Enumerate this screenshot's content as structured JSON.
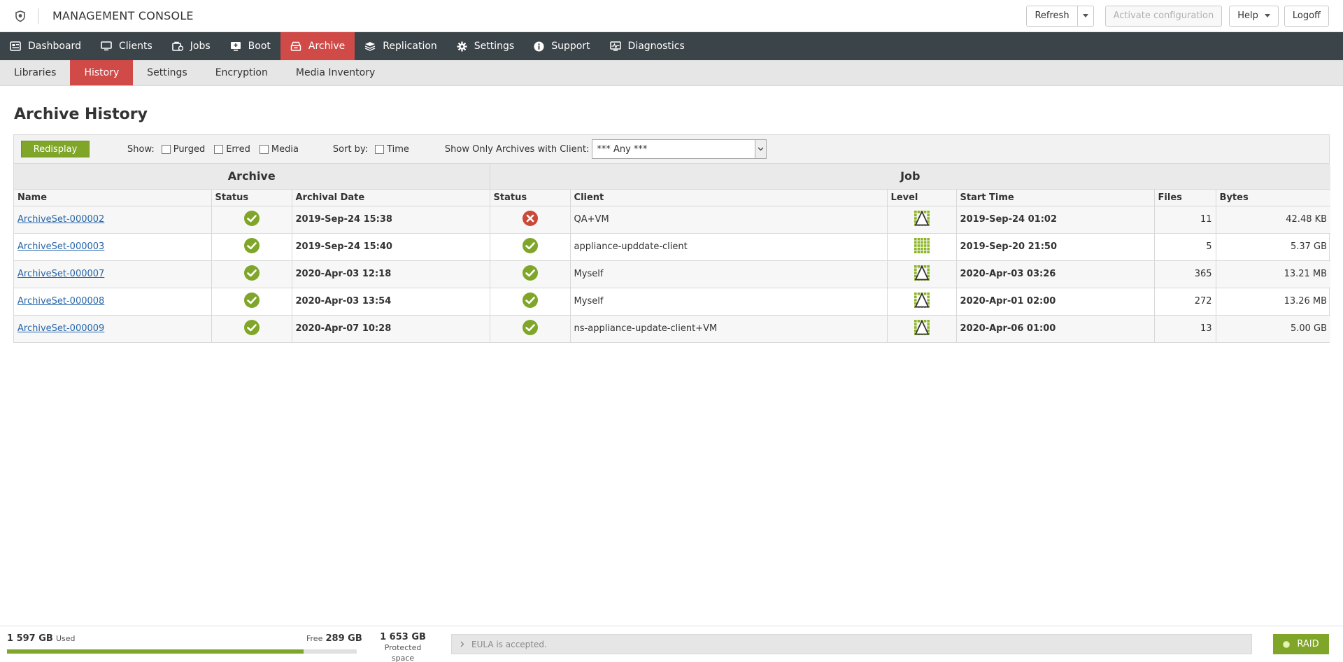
{
  "header": {
    "title": "MANAGEMENT CONSOLE",
    "refresh_label": "Refresh",
    "activate_label": "Activate configuration",
    "help_label": "Help",
    "logoff_label": "Logoff"
  },
  "nav": {
    "items": [
      {
        "label": "Dashboard",
        "icon": "dashboard-icon"
      },
      {
        "label": "Clients",
        "icon": "monitor-icon"
      },
      {
        "label": "Jobs",
        "icon": "jobs-icon"
      },
      {
        "label": "Boot",
        "icon": "boot-icon"
      },
      {
        "label": "Archive",
        "icon": "archive-icon",
        "active": true
      },
      {
        "label": "Replication",
        "icon": "replication-icon"
      },
      {
        "label": "Settings",
        "icon": "gear-icon"
      },
      {
        "label": "Support",
        "icon": "info-icon"
      },
      {
        "label": "Diagnostics",
        "icon": "diagnostics-icon"
      }
    ]
  },
  "subnav": {
    "items": [
      {
        "label": "Libraries"
      },
      {
        "label": "History",
        "active": true
      },
      {
        "label": "Settings"
      },
      {
        "label": "Encryption"
      },
      {
        "label": "Media Inventory"
      }
    ]
  },
  "page": {
    "title": "Archive History"
  },
  "toolbar": {
    "redisplay_label": "Redisplay",
    "show_label": "Show:",
    "purged_label": "Purged",
    "erred_label": "Erred",
    "media_label": "Media",
    "sortby_label": "Sort by:",
    "time_label": "Time",
    "client_filter_label": "Show Only Archives with Client:",
    "client_filter_value": "*** Any ***"
  },
  "table": {
    "group_archive": "Archive",
    "group_job": "Job",
    "columns": [
      "Name",
      "Status",
      "Archival Date",
      "Status",
      "Client",
      "Level",
      "Start Time",
      "Files",
      "Bytes"
    ],
    "rows": [
      {
        "name": "ArchiveSet-000002",
        "archive_status": "ok",
        "archival_date": "2019-Sep-24 15:38",
        "job_status": "error",
        "client": "QA+VM",
        "level": "differential",
        "start_time": "2019-Sep-24 01:02",
        "files": "11",
        "bytes": "42.48 KB"
      },
      {
        "name": "ArchiveSet-000003",
        "archive_status": "ok",
        "archival_date": "2019-Sep-24 15:40",
        "job_status": "ok",
        "client": "appliance-upddate-client",
        "level": "full",
        "start_time": "2019-Sep-20 21:50",
        "files": "5",
        "bytes": "5.37 GB"
      },
      {
        "name": "ArchiveSet-000007",
        "archive_status": "ok",
        "archival_date": "2020-Apr-03 12:18",
        "job_status": "ok",
        "client": "Myself",
        "level": "differential",
        "start_time": "2020-Apr-03 03:26",
        "files": "365",
        "bytes": "13.21 MB"
      },
      {
        "name": "ArchiveSet-000008",
        "archive_status": "ok",
        "archival_date": "2020-Apr-03 13:54",
        "job_status": "ok",
        "client": "Myself",
        "level": "differential",
        "start_time": "2020-Apr-01 02:00",
        "files": "272",
        "bytes": "13.26 MB"
      },
      {
        "name": "ArchiveSet-000009",
        "archive_status": "ok",
        "archival_date": "2020-Apr-07 10:28",
        "job_status": "ok",
        "client": "ns-appliance-update-client+VM",
        "level": "differential",
        "start_time": "2020-Apr-06 01:00",
        "files": "13",
        "bytes": "5.00 GB"
      }
    ]
  },
  "footer": {
    "used_value": "1 597 GB",
    "used_label": "Used",
    "free_label": "Free",
    "free_value": "289 GB",
    "used_fraction": 0.847,
    "protected_value": "1 653 GB",
    "protected_label": "Protected space",
    "eula_text": "EULA is accepted.",
    "raid_label": "RAID"
  },
  "colors": {
    "nav_bg": "#3b4448",
    "active_red": "#d04a48",
    "green": "#7fa629",
    "error_red": "#c94a3a",
    "link": "#2766a8"
  }
}
